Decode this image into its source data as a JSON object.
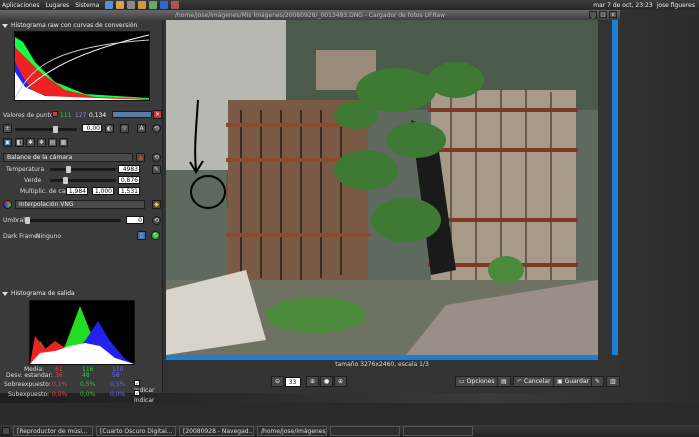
{
  "topbar": {
    "menu": [
      "Aplicaciones",
      "Lugares",
      "Sistema"
    ],
    "date": "mar 7 de oct, 23:23",
    "user": "jose figueres"
  },
  "window": {
    "title": "/home/jose/Imágenes/Mis Imágenes/20080928/_0013493.DNG - Cargador de fotos UFRaw",
    "buttons": [
      "_",
      "□",
      "x"
    ]
  },
  "raw_histogram": {
    "title": "Histograma raw con curvas de conversión"
  },
  "point_values": {
    "label": "Valores de punto:",
    "r": "111",
    "g": "127",
    "b": "0,134",
    "swatch_colors": [
      "#d33",
      "#3c3",
      "#44f"
    ]
  },
  "exposure": {
    "value": "0,00"
  },
  "white_balance": {
    "combo": "Balance de la cámara",
    "temperature_label": "Temperatura",
    "temperature_value": "4983",
    "green_label": "Verde",
    "green_value": "0,876",
    "multipliers_label": "Multiplic. de canal",
    "mult_r": "1,984",
    "mult_g": "1,000",
    "mult_b": "1,531"
  },
  "interpolation": {
    "combo": "Interpolación VNG"
  },
  "threshold": {
    "label": "Umbral",
    "value": "0"
  },
  "dark_frame": {
    "label": "Dark Frame:",
    "value": "Ninguno"
  },
  "output_histogram": {
    "title": "Histograma de salida"
  },
  "stats": {
    "headers": [
      "Media:",
      "Desv. estandar:",
      "Sobreexpuesto:",
      "Subexpuesto:"
    ],
    "media": [
      "61",
      "116",
      "110"
    ],
    "desv": [
      "36",
      "48",
      "58"
    ],
    "sobre": [
      "0,1%",
      "0,5%",
      "0,5%"
    ],
    "sub": [
      "0,0%",
      "0,0%",
      "0,0%"
    ],
    "indicar": "Indicar"
  },
  "status": {
    "text": "tamaño 3276x2460, escala 1/3"
  },
  "zoom": {
    "value": "33"
  },
  "buttons": {
    "options": "Opciones",
    "cancel": "Cancelar",
    "save": "Guardar"
  },
  "taskbar": {
    "tasks": [
      "[Reproductor de músi...",
      "[Cuarto Oscuro Digital...",
      "[20080928 - Navegad...",
      "/home/jose/Imágenes/...",
      "",
      ""
    ]
  }
}
